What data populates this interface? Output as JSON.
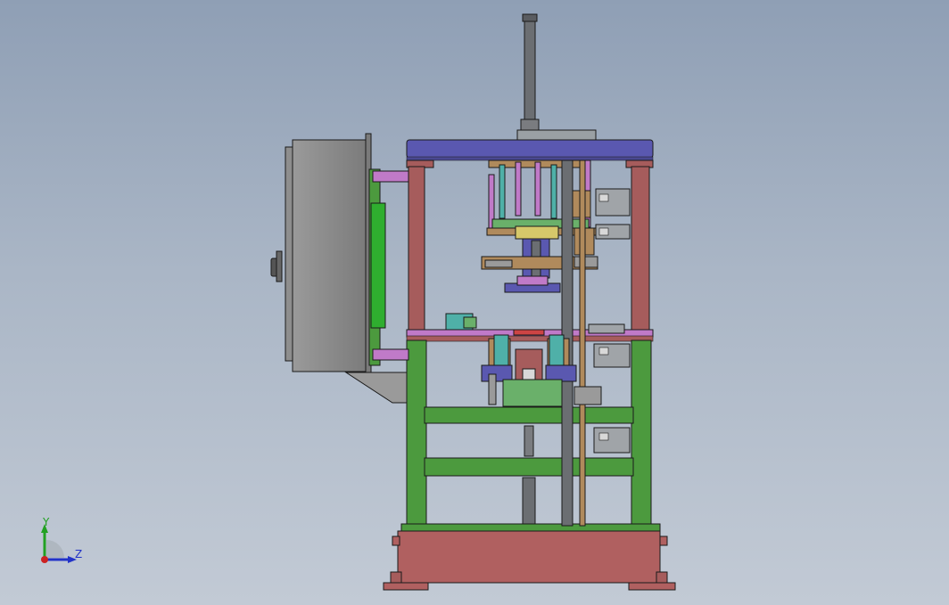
{
  "viewport": {
    "background_top": "#8f9fb5",
    "background_bottom": "#c2cad5"
  },
  "colors": {
    "frame_red": "#a65c5c",
    "frame_green": "#4c9a3e",
    "top_plate_blue": "#5a58b0",
    "cabinet_grey": "#8a8a8a",
    "cylinder_grey": "#6b6e72",
    "magenta": "#c07ac8",
    "teal": "#4fb0a8",
    "tan": "#b08a5c",
    "base_red": "#b06060",
    "outline": "#1a1a1a"
  },
  "triad": {
    "y_label": "Y",
    "z_label": "Z",
    "y_color": "#22a022",
    "z_color": "#2233c8",
    "origin_color": "#cc2222"
  }
}
